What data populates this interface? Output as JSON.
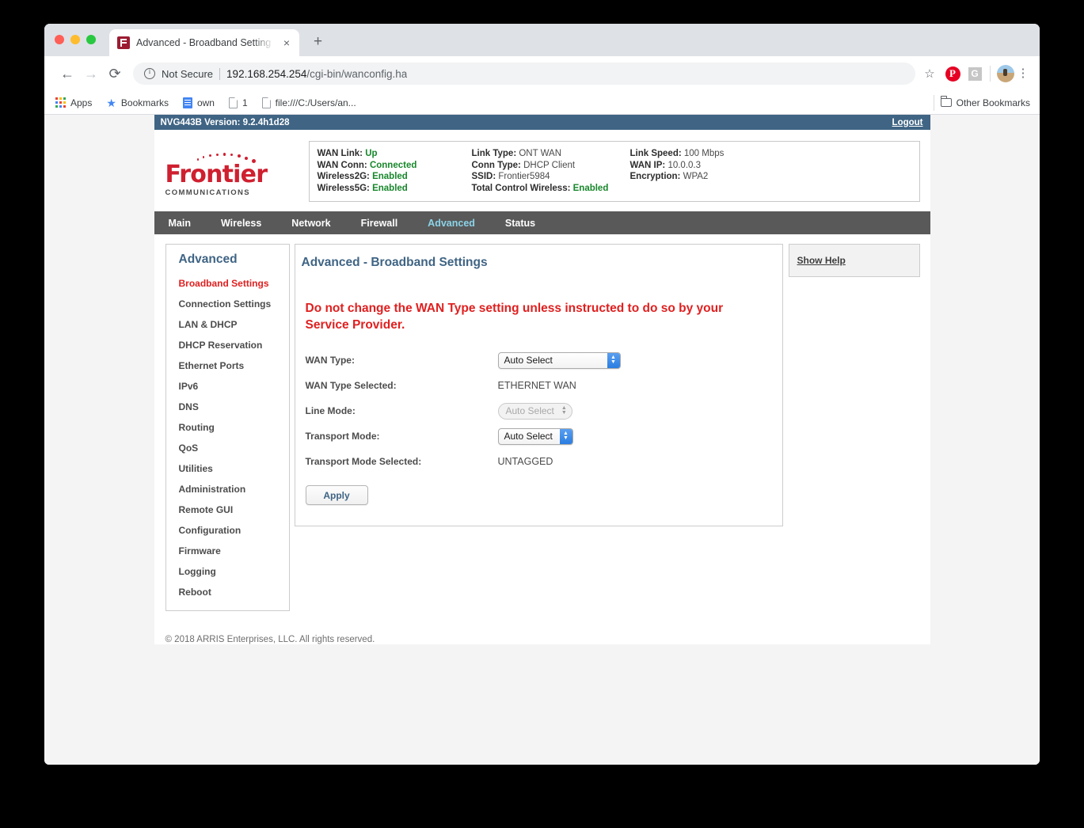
{
  "browser": {
    "tab": {
      "title": "Advanced - Broadband Setting",
      "favicon": "frontier-f-icon",
      "close": "×"
    },
    "new_tab": "+",
    "nav": {
      "back": "←",
      "forward": "→",
      "reload": "⟳"
    },
    "omnibox": {
      "info_icon": "info-icon",
      "security_label": "Not Secure",
      "url_host": "192.168.254.254",
      "url_path": "/cgi-bin/wanconfig.ha",
      "star": "☆"
    },
    "extensions": [
      {
        "name": "pinterest-extension-icon",
        "label": "P"
      },
      {
        "name": "grammarly-extension-icon",
        "label": "G"
      }
    ],
    "profile_avatar": "user-avatar",
    "menu": "⋮",
    "bookmarks": [
      {
        "label": "Apps",
        "icon": "apps-grid-icon"
      },
      {
        "label": "Bookmarks",
        "icon": "star-icon"
      },
      {
        "label": "own",
        "icon": "document-blue-icon"
      },
      {
        "label": "1",
        "icon": "document-icon"
      },
      {
        "label": "file:///C:/Users/an...",
        "icon": "document-icon"
      }
    ],
    "other_bookmarks": {
      "label": "Other Bookmarks",
      "icon": "folder-icon"
    }
  },
  "router": {
    "version_bar": {
      "text": "NVG443B Version: 9.2.4h1d28",
      "logout": "Logout"
    },
    "logo": {
      "brand": "Frontier",
      "sub": "COMMUNICATIONS"
    },
    "status": {
      "columns": [
        [
          {
            "label": "WAN Link:",
            "value": "Up",
            "state": "ok"
          },
          {
            "label": "WAN Conn:",
            "value": "Connected",
            "state": "ok"
          },
          {
            "label": "Wireless2G:",
            "value": "Enabled",
            "state": "ok"
          },
          {
            "label": "Wireless5G:",
            "value": "Enabled",
            "state": "ok"
          }
        ],
        [
          {
            "label": "Link Type:",
            "value": "ONT WAN",
            "state": "plain"
          },
          {
            "label": "Conn Type:",
            "value": "DHCP Client",
            "state": "plain"
          },
          {
            "label": "SSID:",
            "value": "Frontier5984",
            "state": "plain"
          },
          {
            "label": "Total Control Wireless:",
            "value": "Enabled",
            "state": "ok"
          }
        ],
        [
          {
            "label": "Link Speed:",
            "value": "100 Mbps",
            "state": "plain"
          },
          {
            "label": "WAN IP:",
            "value": "10.0.0.3",
            "state": "plain"
          },
          {
            "label": "Encryption:",
            "value": "WPA2",
            "state": "plain"
          }
        ]
      ]
    },
    "navbar": [
      {
        "label": "Main",
        "active": false
      },
      {
        "label": "Wireless",
        "active": false
      },
      {
        "label": "Network",
        "active": false
      },
      {
        "label": "Firewall",
        "active": false
      },
      {
        "label": "Advanced",
        "active": true
      },
      {
        "label": "Status",
        "active": false
      }
    ],
    "sidebar": {
      "title": "Advanced",
      "items": [
        {
          "label": "Broadband Settings",
          "active": true
        },
        {
          "label": "Connection Settings",
          "active": false
        },
        {
          "label": "LAN & DHCP",
          "active": false
        },
        {
          "label": "DHCP Reservation",
          "active": false
        },
        {
          "label": "Ethernet Ports",
          "active": false
        },
        {
          "label": "IPv6",
          "active": false
        },
        {
          "label": "DNS",
          "active": false
        },
        {
          "label": "Routing",
          "active": false
        },
        {
          "label": "QoS",
          "active": false
        },
        {
          "label": "Utilities",
          "active": false
        },
        {
          "label": "Administration",
          "active": false
        },
        {
          "label": "Remote GUI",
          "active": false
        },
        {
          "label": "Configuration",
          "active": false
        },
        {
          "label": "Firmware",
          "active": false
        },
        {
          "label": "Logging",
          "active": false
        },
        {
          "label": "Reboot",
          "active": false
        }
      ]
    },
    "content": {
      "title": "Advanced - Broadband Settings",
      "warning": "Do not change the WAN Type setting unless instructed to do so by your Service Provider.",
      "fields": {
        "wan_type_label": "WAN Type:",
        "wan_type_value": "Auto Select",
        "wan_type_selected_label": "WAN Type Selected:",
        "wan_type_selected_value": "ETHERNET WAN",
        "line_mode_label": "Line Mode:",
        "line_mode_value": "Auto Select",
        "transport_mode_label": "Transport Mode:",
        "transport_mode_value": "Auto Select",
        "transport_mode_selected_label": "Transport Mode Selected:",
        "transport_mode_selected_value": "UNTAGGED"
      },
      "apply_label": "Apply"
    },
    "help": {
      "link": "Show Help"
    },
    "footer": "© 2018 ARRIS Enterprises, LLC. All rights reserved.",
    "colors": {
      "header_blue": "#3f6484",
      "nav_gray": "#595959",
      "accent_active": "#8cd3e8",
      "brand_red": "#cf2030",
      "warning_red": "#e02020",
      "status_green": "#17872b"
    }
  }
}
